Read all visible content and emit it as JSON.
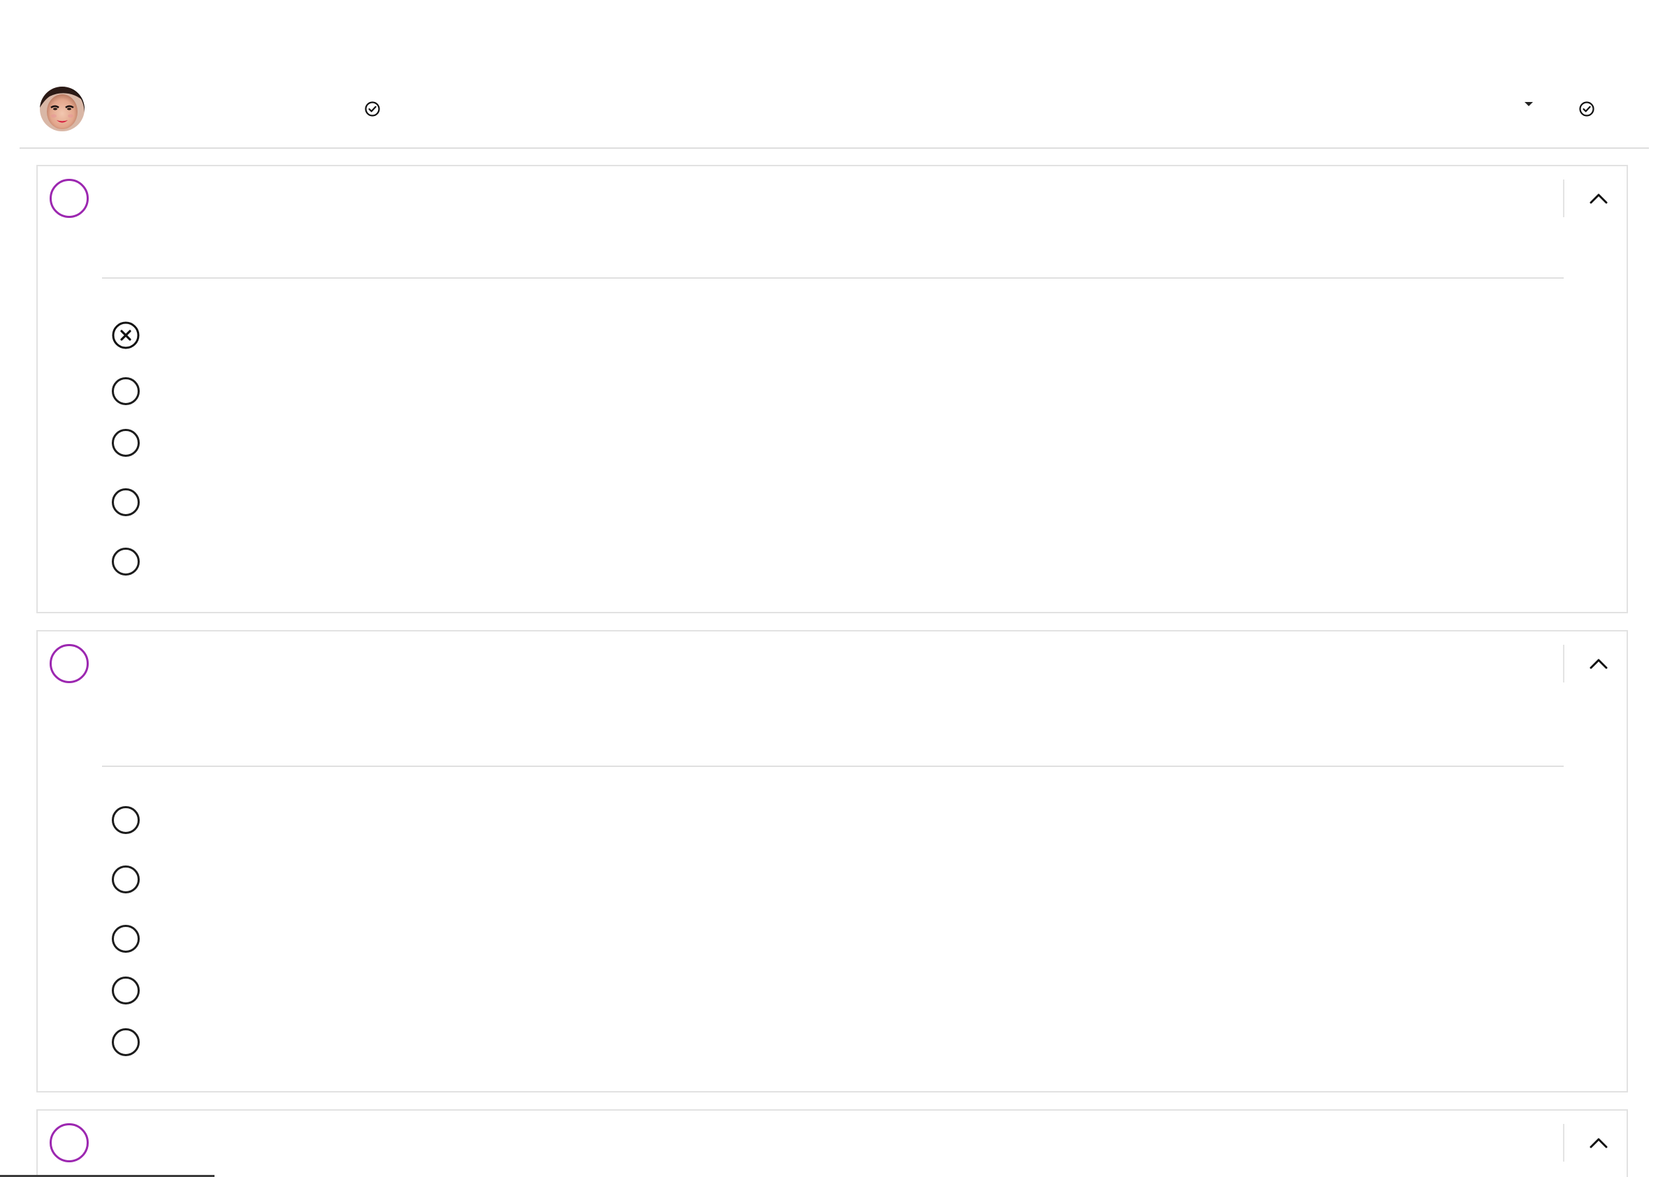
{
  "header": {
    "user_name": "",
    "status_text": "",
    "accent_color": "#9c27b0",
    "icons": [
      "check-circle-icon",
      "caret-down-icon",
      "check-circle-icon"
    ]
  },
  "cards": [
    {
      "question": "",
      "options": [
        {
          "label": "",
          "state": "incorrect-selected"
        },
        {
          "label": "",
          "state": "unselected"
        },
        {
          "label": "",
          "state": "unselected"
        },
        {
          "label": "",
          "state": "unselected"
        },
        {
          "label": "",
          "state": "unselected"
        }
      ]
    },
    {
      "question": "",
      "options": [
        {
          "label": "",
          "state": "unselected"
        },
        {
          "label": "",
          "state": "unselected"
        },
        {
          "label": "",
          "state": "unselected"
        },
        {
          "label": "",
          "state": "unselected"
        },
        {
          "label": "",
          "state": "unselected"
        }
      ]
    },
    {
      "question": ""
    }
  ]
}
